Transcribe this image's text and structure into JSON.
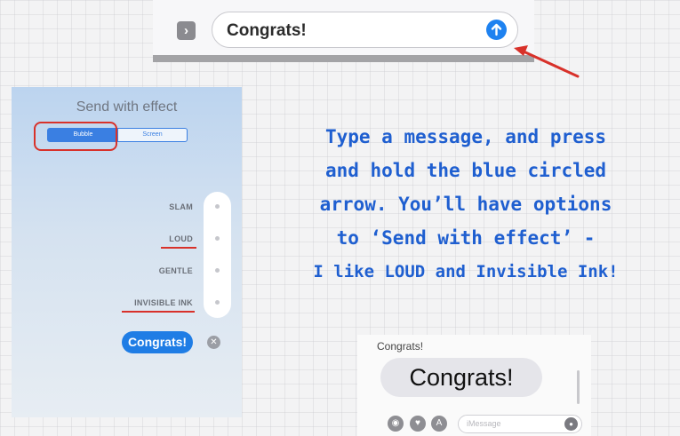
{
  "top_compose": {
    "message_text": "Congrats!",
    "apps_icon": "chevron-right-icon",
    "send_icon": "arrow-up-circle-icon",
    "send_color": "#1e82f0"
  },
  "annotation_arrow_color": "#d8312a",
  "effect_panel": {
    "title": "Send with effect",
    "segments": [
      "Bubble",
      "Screen"
    ],
    "selected_segment": "Bubble",
    "effects": [
      "SLAM",
      "LOUD",
      "GENTLE",
      "INVISIBLE INK"
    ],
    "underlined_effects": [
      "LOUD",
      "INVISIBLE INK"
    ],
    "bubble_text": "Congrats!",
    "cancel_icon": "close-icon"
  },
  "instructions": {
    "line1": "Type a message, and press",
    "line2": "and hold the blue circled",
    "line3": "arrow. You’ll have options",
    "line4": "to ‘Send with effect’ -",
    "line5": "I like LOUD and Invisible Ink!"
  },
  "example": {
    "small_label": "Congrats!",
    "loud_bubble": "Congrats!",
    "input_placeholder": "iMessage",
    "toolbar_icons": [
      "camera-icon",
      "digital-touch-icon",
      "app-store-icon"
    ],
    "mic_icon": "microphone-icon"
  }
}
